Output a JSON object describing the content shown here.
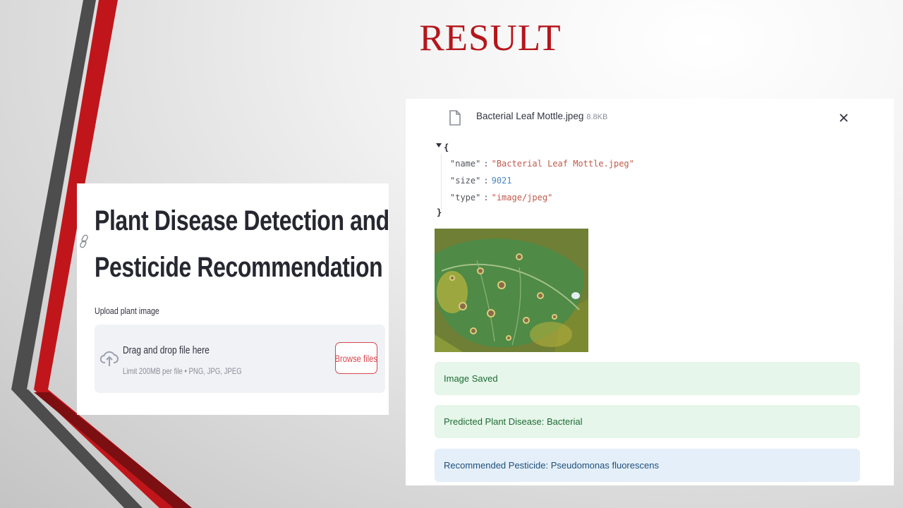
{
  "slide": {
    "title": "RESULT",
    "accent_color": "#b5161b"
  },
  "app": {
    "title_line1": "Plant Disease Detection and",
    "title_line2": "Pesticide Recommendation",
    "upload": {
      "label": "Upload plant image",
      "drop_text": "Drag and drop file here",
      "limit_text": "Limit 200MB per file • PNG, JPG, JPEG",
      "browse_label": "Browse files"
    }
  },
  "result": {
    "file": {
      "name": "Bacterial Leaf Mottle.jpeg",
      "size": "8.8KB"
    },
    "json": {
      "open_brace": "{",
      "close_brace": "}",
      "name_key": "\"name\"",
      "name_value": "\"Bacterial Leaf Mottle.jpeg\"",
      "size_key": "\"size\"",
      "size_value": "9021",
      "type_key": "\"type\"",
      "type_value": "\"image/jpeg\"",
      "sep": ":"
    },
    "alerts": {
      "saved": "Image Saved",
      "prediction": "Predicted Plant Disease: Bacterial",
      "pesticide": "Recommended Pesticide: Pseudomonas fluorescens"
    },
    "colors": {
      "success_bg": "#e6f6ea",
      "info_bg": "#e5eff9",
      "button_red": "#d7474d"
    }
  }
}
